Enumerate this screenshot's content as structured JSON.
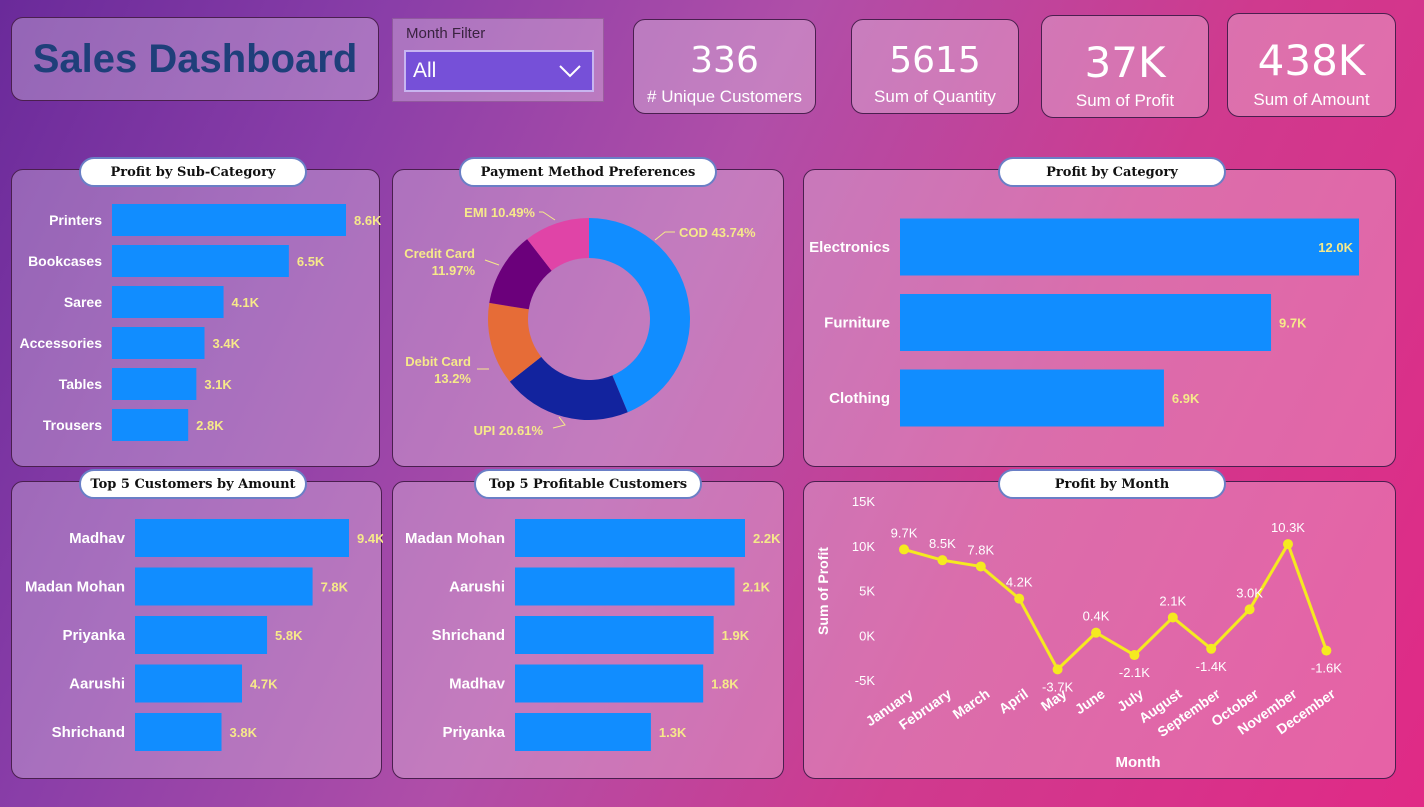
{
  "header": {
    "title": "Sales Dashboard",
    "filter_label": "Month Filter",
    "filter_value": "All"
  },
  "kpis": [
    {
      "value": "336",
      "label": "# Unique Customers"
    },
    {
      "value": "5615",
      "label": "Sum of Quantity"
    },
    {
      "value": "37K",
      "label": "Sum of Profit"
    },
    {
      "value": "438K",
      "label": "Sum of Amount"
    }
  ],
  "colors": {
    "bar": "#118dff",
    "bar_label": "#f6e98a",
    "line": "#f5ea20",
    "donut": [
      "#118dff",
      "#12239e",
      "#e66c37",
      "#6b007b",
      "#e044a7"
    ]
  },
  "chart_data": [
    {
      "type": "bar",
      "orientation": "horizontal",
      "title": "Profit by Sub-Category",
      "categories": [
        "Printers",
        "Bookcases",
        "Saree",
        "Accessories",
        "Tables",
        "Trousers"
      ],
      "values": [
        8.6,
        6.5,
        4.1,
        3.4,
        3.1,
        2.8
      ],
      "labels": [
        "8.6K",
        "6.5K",
        "4.1K",
        "3.4K",
        "3.1K",
        "2.8K"
      ],
      "xlim": [
        0,
        8.6
      ]
    },
    {
      "type": "pie",
      "donut": true,
      "title": "Payment Method Preferences",
      "categories": [
        "COD",
        "UPI",
        "Debit Card",
        "Credit Card",
        "EMI"
      ],
      "values": [
        43.74,
        20.61,
        13.2,
        11.97,
        10.49
      ],
      "labels": [
        "COD 43.74%",
        "UPI 20.61%",
        "Debit Card 13.2%",
        "Credit Card 11.97%",
        "EMI 10.49%"
      ]
    },
    {
      "type": "bar",
      "orientation": "horizontal",
      "title": "Profit by Category",
      "categories": [
        "Electronics",
        "Furniture",
        "Clothing"
      ],
      "values": [
        12.0,
        9.7,
        6.9
      ],
      "labels": [
        "12.0K",
        "9.7K",
        "6.9K"
      ],
      "xlim": [
        0,
        12.0
      ]
    },
    {
      "type": "bar",
      "orientation": "horizontal",
      "title": "Top 5 Customers by Amount",
      "categories": [
        "Madhav",
        "Madan Mohan",
        "Priyanka",
        "Aarushi",
        "Shrichand"
      ],
      "values": [
        9.4,
        7.8,
        5.8,
        4.7,
        3.8
      ],
      "labels": [
        "9.4K",
        "7.8K",
        "5.8K",
        "4.7K",
        "3.8K"
      ],
      "xlim": [
        0,
        9.4
      ]
    },
    {
      "type": "bar",
      "orientation": "horizontal",
      "title": "Top 5 Profitable Customers",
      "categories": [
        "Madan Mohan",
        "Aarushi",
        "Shrichand",
        "Madhav",
        "Priyanka"
      ],
      "values": [
        2.2,
        2.1,
        1.9,
        1.8,
        1.3
      ],
      "labels": [
        "2.2K",
        "2.1K",
        "1.9K",
        "1.8K",
        "1.3K"
      ],
      "xlim": [
        0,
        2.2
      ]
    },
    {
      "type": "line",
      "title": "Profit by Month",
      "xlabel": "Month",
      "ylabel": "Sum of Profit",
      "x": [
        "January",
        "February",
        "March",
        "April",
        "May",
        "June",
        "July",
        "August",
        "September",
        "October",
        "November",
        "December"
      ],
      "values": [
        9.7,
        8.5,
        7.8,
        4.2,
        -3.7,
        0.4,
        -2.1,
        2.1,
        -1.4,
        3.0,
        10.3,
        -1.6
      ],
      "labels": [
        "9.7K",
        "8.5K",
        "7.8K",
        "4.2K",
        "-3.7K",
        "0.4K",
        "-2.1K",
        "2.1K",
        "-1.4K",
        "3.0K",
        "10.3K",
        "-1.6K"
      ],
      "yticks": [
        "15K",
        "10K",
        "5K",
        "0K",
        "-5K"
      ],
      "ytick_values": [
        15,
        10,
        5,
        0,
        -5
      ],
      "ylim": [
        -5,
        15
      ]
    }
  ]
}
